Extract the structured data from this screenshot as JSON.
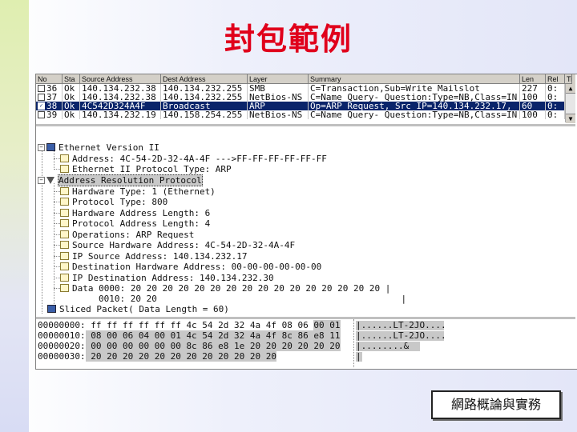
{
  "slide": {
    "title": "封包範例",
    "footer_label": "網路概論與實務"
  },
  "packet_list": {
    "columns": [
      "No",
      "Sta",
      "Source Address",
      "Dest Address",
      "Layer",
      "Summary",
      "Len",
      "Rel",
      "Ti"
    ],
    "rows": [
      {
        "no": "36",
        "checked": false,
        "status": "Ok",
        "src": "140.134.232.38",
        "dst": "140.134.232.255",
        "layer": "SMB",
        "summary": "C=Transaction,Sub=Write_Mailslot",
        "len": "227",
        "rel": "0:"
      },
      {
        "no": "37",
        "checked": false,
        "status": "Ok",
        "src": "140.134.232.38",
        "dst": "140.134.232.255",
        "layer": "NetBios-NS",
        "summary": "C=Name Query- Question:Type=NB,Class=IN",
        "len": "100",
        "rel": "0:"
      },
      {
        "no": "38",
        "checked": true,
        "status": "Ok",
        "src": "4C542D324A4F",
        "dst": "Broadcast",
        "layer": "ARP",
        "summary": "Op=ARP Request, Src IP=140.134.232.17,",
        "len": "60",
        "rel": "0:"
      },
      {
        "no": "39",
        "checked": false,
        "status": "Ok",
        "src": "140.134.232.19",
        "dst": "140.158.254.255",
        "layer": "NetBios-NS",
        "summary": "C=Name Query- Question:Type=NB,Class=IN",
        "len": "100",
        "rel": "0:"
      }
    ],
    "selected_index": 2
  },
  "tree": {
    "n0": "Ethernet Version II",
    "n1": "Address: 4C-54-2D-32-4A-4F --->FF-FF-FF-FF-FF-FF",
    "n2": "Ethernet II Protocol Type: ARP",
    "n3": "Address Resolution Protocol",
    "n4": "Hardware Type: 1 (Ethernet)",
    "n5": "Protocol Type: 800",
    "n6": "Hardware Address Length: 6",
    "n7": "Protocol Address Length: 4",
    "n8": "Operations: ARP Request",
    "n9": "Source Hardware Address: 4C-54-2D-32-4A-4F",
    "n10": "IP Source Address: 140.134.232.17",
    "n11": "Destination Hardware Address: 00-00-00-00-00-00",
    "n12": "IP Destination Address: 140.134.232.30",
    "n13": "Data 0000: 20 20 20 20 20 20 20 20 20 20 20 20 20 20 20 20 |",
    "n14": "0010: 20 20                                              |",
    "n15": "Sliced Packet( Data Length = 60)"
  },
  "hex_dump": {
    "r0_off": "00000000:",
    "r0_bytes_a": " ff ff ff ff ff ff 4c 54 2d 32 4a 4f 08 06 ",
    "r0_bytes_b": "00 01",
    "r0_ascii": "|......LT-2JO....",
    "r1_off": "00000010:",
    "r1_bytes": " 08 00 06 04 00 01 4c 54 2d 32 4a 4f 8c 86 e8 11",
    "r1_ascii": "|......LT-2JO....",
    "r2_off": "00000020:",
    "r2_bytes": " 00 00 00 00 00 00 8c 86 e8 1e 20 20 20 20 20 20",
    "r2_ascii": "|........&",
    "r3_off": "00000030:",
    "r3_bytes": " 20 20 20 20 20 20 20 20 20 20 20 20",
    "r3_ascii": "|"
  }
}
